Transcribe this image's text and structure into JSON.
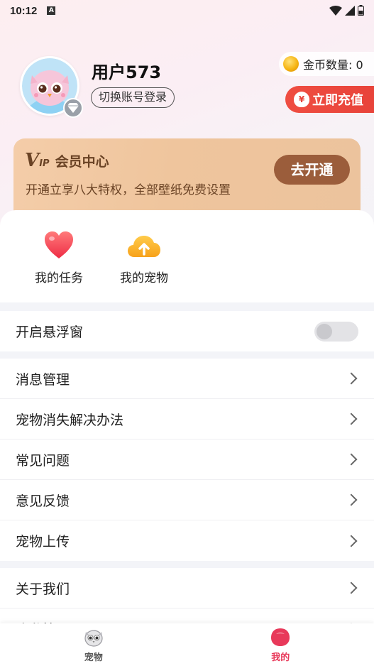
{
  "status_bar": {
    "time": "10:12",
    "notif": "A"
  },
  "profile": {
    "username": "用户573",
    "switch_label": "切换账号登录"
  },
  "coins": {
    "label": "金币数量: 0"
  },
  "recharge": {
    "label": "立即充值",
    "bag_symbol": "¥"
  },
  "vip": {
    "logo_v": "V",
    "logo_ip": "IP",
    "title": "会员中心",
    "desc": "开通立享八大特权，全部壁纸免费设置",
    "open_label": "去开通"
  },
  "quick_actions": [
    {
      "label": "我的任务",
      "icon": "heart-icon"
    },
    {
      "label": "我的宠物",
      "icon": "cloud-upload-icon"
    }
  ],
  "floating_window": {
    "label": "开启悬浮窗",
    "enabled": false
  },
  "menu_group_1": [
    {
      "label": "消息管理"
    },
    {
      "label": "宠物消失解决办法"
    },
    {
      "label": "常见问题"
    },
    {
      "label": "意见反馈"
    },
    {
      "label": "宠物上传"
    }
  ],
  "menu_group_2": [
    {
      "label": "关于我们"
    },
    {
      "label": "隐私管理"
    }
  ],
  "tabbar": {
    "tabs": [
      {
        "label": "宠物",
        "active": false
      },
      {
        "label": "我的",
        "active": true
      }
    ]
  },
  "colors": {
    "accent": "#e8433a",
    "tab_active": "#e8395a",
    "vip_brown": "#9b5d3b"
  }
}
